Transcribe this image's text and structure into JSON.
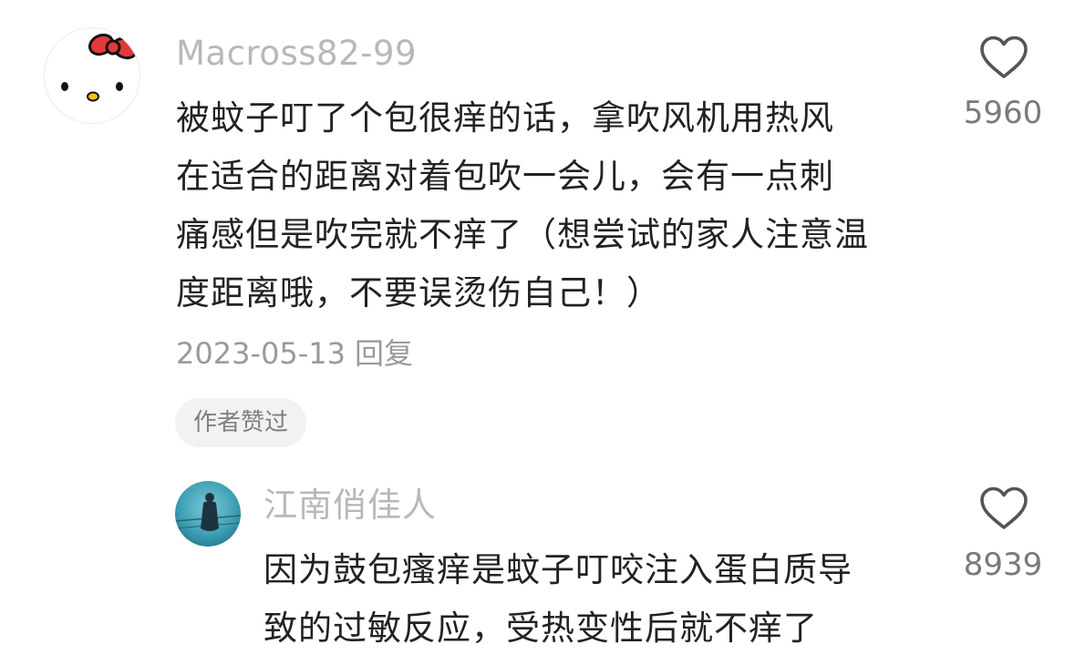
{
  "comment": {
    "username": "Macross82-99",
    "avatar_icon": "hello-kitty-avatar",
    "text_lines": [
      "被蚊子叮了个包很痒的话，拿吹风机用热风",
      "在适合的距离对着包吹一会儿，会有一点刺",
      "痛感但是吹完就不痒了（想尝试的家人注意温",
      "度距离哦，不要误烫伤自己！）"
    ],
    "date": "2023-05-13",
    "reply_label": "回复",
    "badge": "作者赞过",
    "like_icon": "heart-outline-icon",
    "like_count": "5960"
  },
  "reply": {
    "username": "江南俏佳人",
    "avatar_icon": "silhouette-teal-avatar",
    "text_lines": [
      "因为鼓包瘙痒是蚊子叮咬注入蛋白质导",
      "致的过敏反应，受热变性后就不痒了"
    ],
    "like_icon": "heart-outline-icon",
    "like_count": "8939"
  },
  "colors": {
    "username": "#b8b8b8",
    "body_text": "#222222",
    "meta": "#9a9a9a",
    "badge_bg": "#f2f2f2",
    "avatar_bow": "#e03a3a",
    "avatar_teal": "#3e9fb4"
  }
}
